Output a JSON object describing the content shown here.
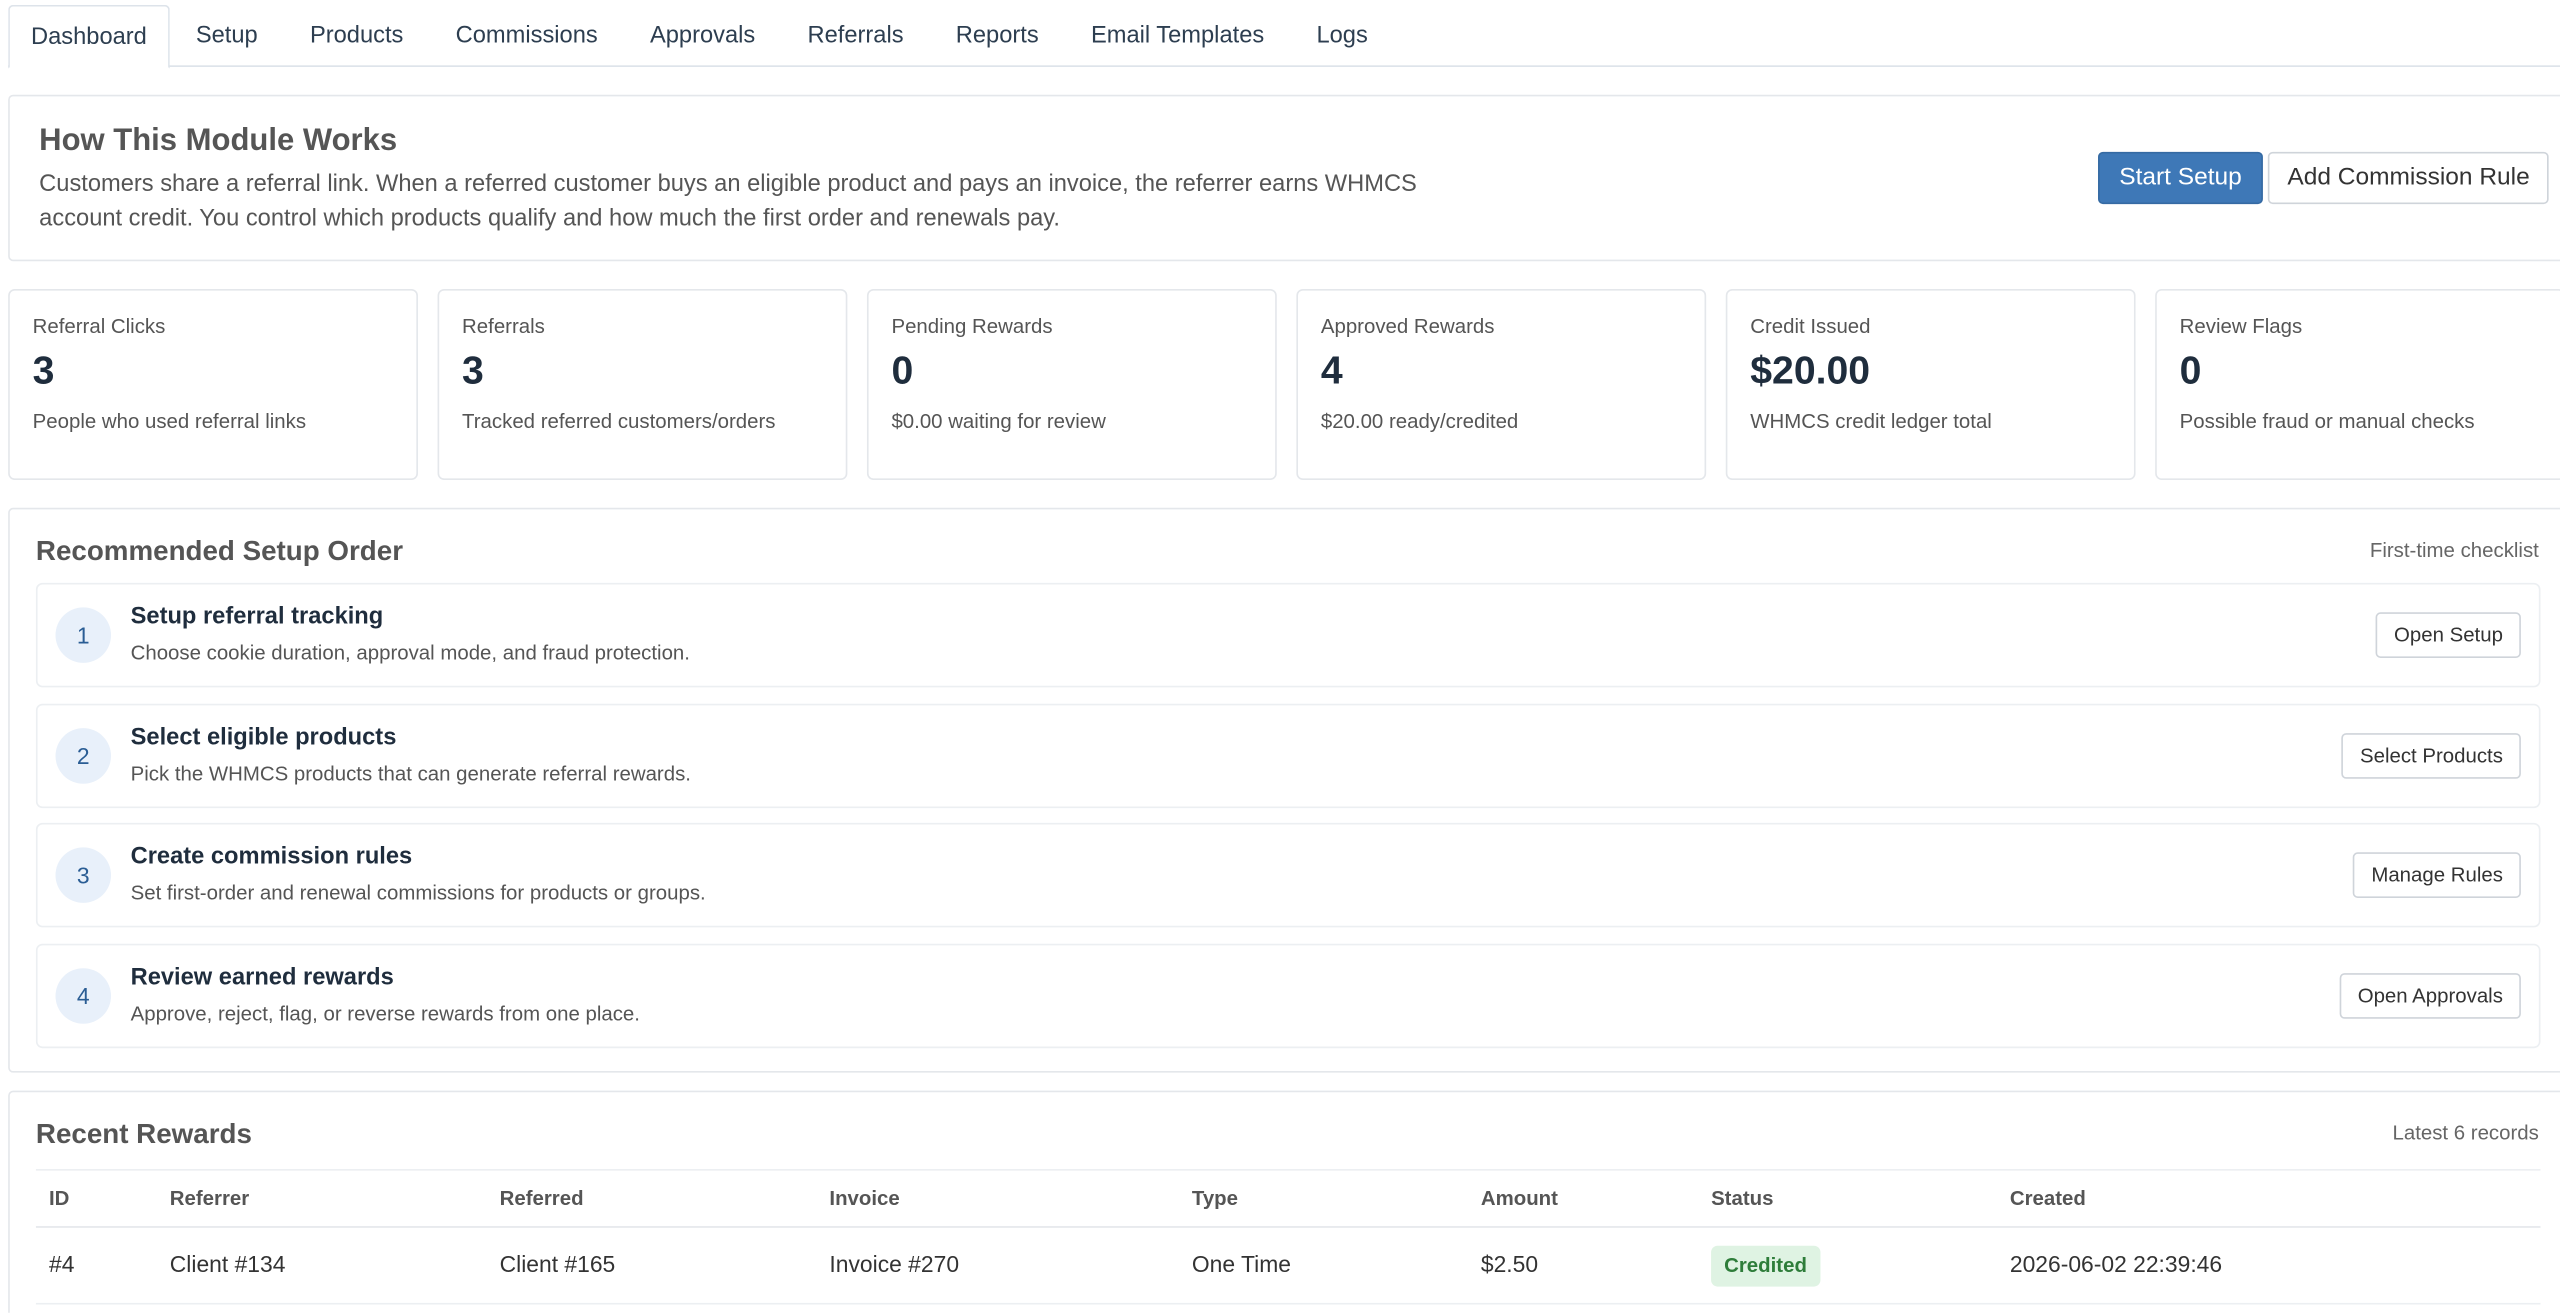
{
  "tabs": [
    "Dashboard",
    "Setup",
    "Products",
    "Commissions",
    "Approvals",
    "Referrals",
    "Reports",
    "Email Templates",
    "Logs"
  ],
  "intro": {
    "title": "How This Module Works",
    "text": "Customers share a referral link. When a referred customer buys an eligible product and pays an invoice, the referrer earns WHMCS account credit. You control which products qualify and how much the first order and renewals pay.",
    "start_setup": "Start Setup",
    "add_rule": "Add Commission Rule"
  },
  "stats": [
    {
      "label": "Referral Clicks",
      "value": "3",
      "desc": "People who used referral links"
    },
    {
      "label": "Referrals",
      "value": "3",
      "desc": "Tracked referred customers/orders"
    },
    {
      "label": "Pending Rewards",
      "value": "0",
      "desc": "$0.00 waiting for review"
    },
    {
      "label": "Approved Rewards",
      "value": "4",
      "desc": "$20.00 ready/credited"
    },
    {
      "label": "Credit Issued",
      "value": "$20.00",
      "desc": "WHMCS credit ledger total"
    },
    {
      "label": "Review Flags",
      "value": "0",
      "desc": "Possible fraud or manual checks"
    }
  ],
  "setup": {
    "title": "Recommended Setup Order",
    "note": "First-time checklist",
    "steps": [
      {
        "num": "1",
        "title": "Setup referral tracking",
        "desc": "Choose cookie duration, approval mode, and fraud protection.",
        "button": "Open Setup"
      },
      {
        "num": "2",
        "title": "Select eligible products",
        "desc": "Pick the WHMCS products that can generate referral rewards.",
        "button": "Select Products"
      },
      {
        "num": "3",
        "title": "Create commission rules",
        "desc": "Set first-order and renewal commissions for products or groups.",
        "button": "Manage Rules"
      },
      {
        "num": "4",
        "title": "Review earned rewards",
        "desc": "Approve, reject, flag, or reverse rewards from one place.",
        "button": "Open Approvals"
      }
    ]
  },
  "rewards": {
    "title": "Recent Rewards",
    "note": "Latest 6 records",
    "columns": [
      "ID",
      "Referrer",
      "Referred",
      "Invoice",
      "Type",
      "Amount",
      "Status",
      "Created"
    ],
    "rows": [
      {
        "id": "#4",
        "referrer": "Client #134",
        "referred": "Client #165",
        "invoice": "Invoice #270",
        "type": "One Time",
        "amount": "$2.50",
        "status": "Credited",
        "created": "2026-06-02 22:39:46"
      }
    ]
  },
  "colors": {
    "primary": "#3e78b7",
    "badge_bg": "#dff3e3",
    "badge_text": "#2e7d3a"
  }
}
